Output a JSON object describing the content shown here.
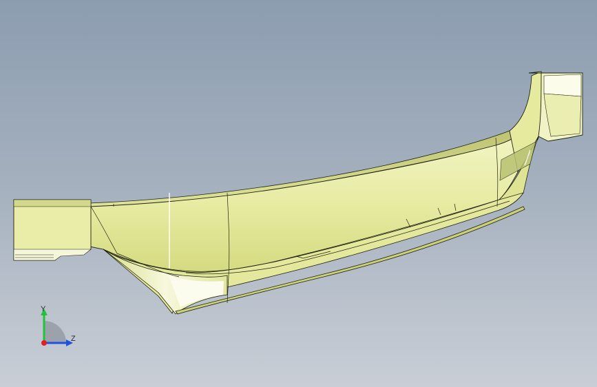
{
  "viewport": {
    "background_top": "#8c9db0",
    "background_bottom": "#c9ced6"
  },
  "model": {
    "part_color": "#ecefb0",
    "shadow_color": "#c9cf7a",
    "edge_color": "#1d2010",
    "highlight_color": "#ffffff"
  },
  "triad": {
    "y_label": "Y",
    "z_label": "Z",
    "y_axis_color": "#22c23a",
    "z_axis_color": "#2050e0",
    "x_axis_color": "#e02020"
  }
}
